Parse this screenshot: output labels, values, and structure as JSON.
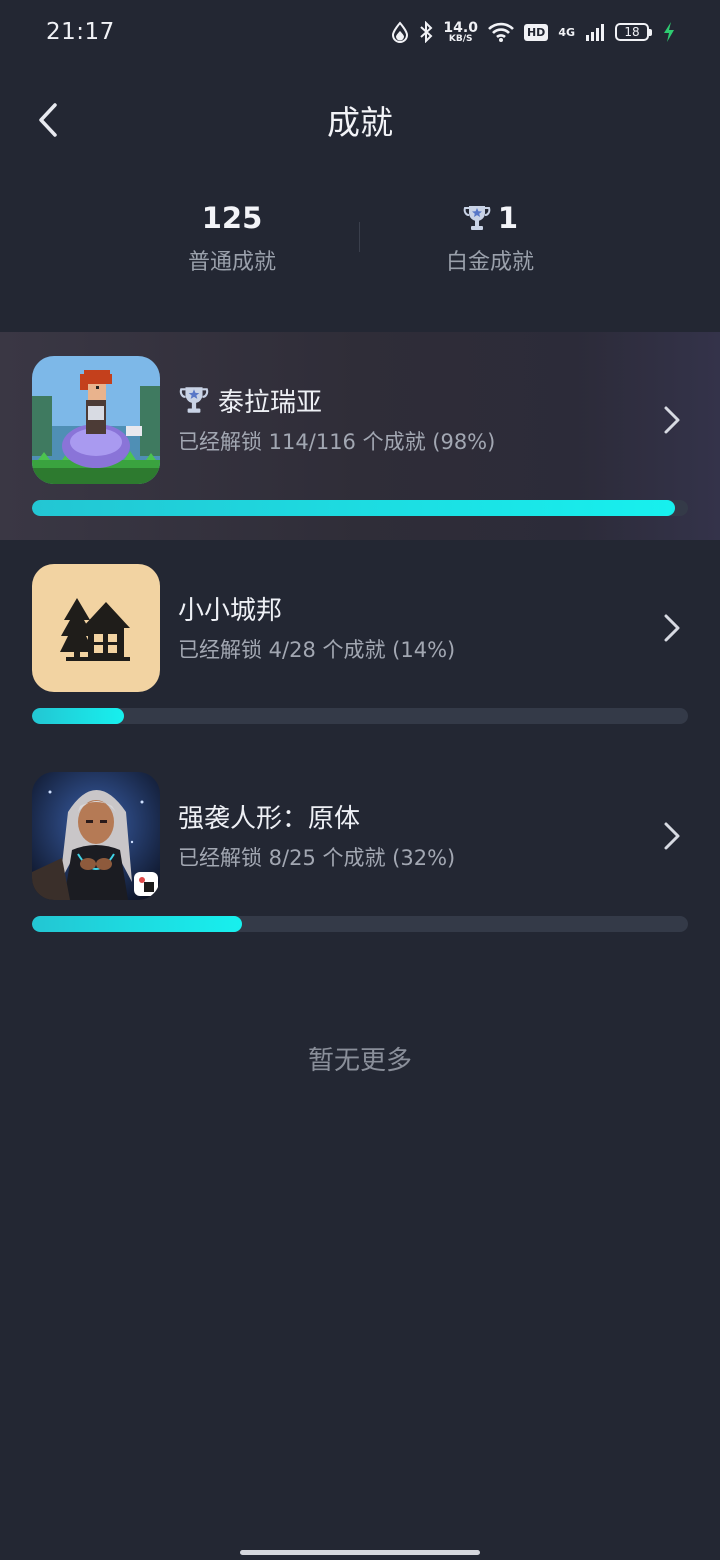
{
  "status_bar": {
    "time": "21:17",
    "speed_value": "14.0",
    "speed_unit": "KB/S",
    "hd": "HD",
    "network": "4G",
    "battery": "18"
  },
  "header": {
    "title": "成就"
  },
  "summary": {
    "normal_count": "125",
    "normal_label": "普通成就",
    "platinum_count": "1",
    "platinum_label": "白金成就"
  },
  "games": [
    {
      "name": "泰拉瑞亚",
      "progress_text": "已经解锁 114/116 个成就 (98%)",
      "percent": 98,
      "platinum": true
    },
    {
      "name": "小小城邦",
      "progress_text": "已经解锁 4/28 个成就 (14%)",
      "percent": 14,
      "platinum": false
    },
    {
      "name": "强袭人形：原体",
      "progress_text": "已经解锁 8/25 个成就 (32%)",
      "percent": 32,
      "platinum": false
    }
  ],
  "footer": {
    "no_more": "暂无更多"
  },
  "colors": {
    "background": "#232733",
    "progress_fill": "#17f0ee",
    "progress_track": "#343a48"
  }
}
